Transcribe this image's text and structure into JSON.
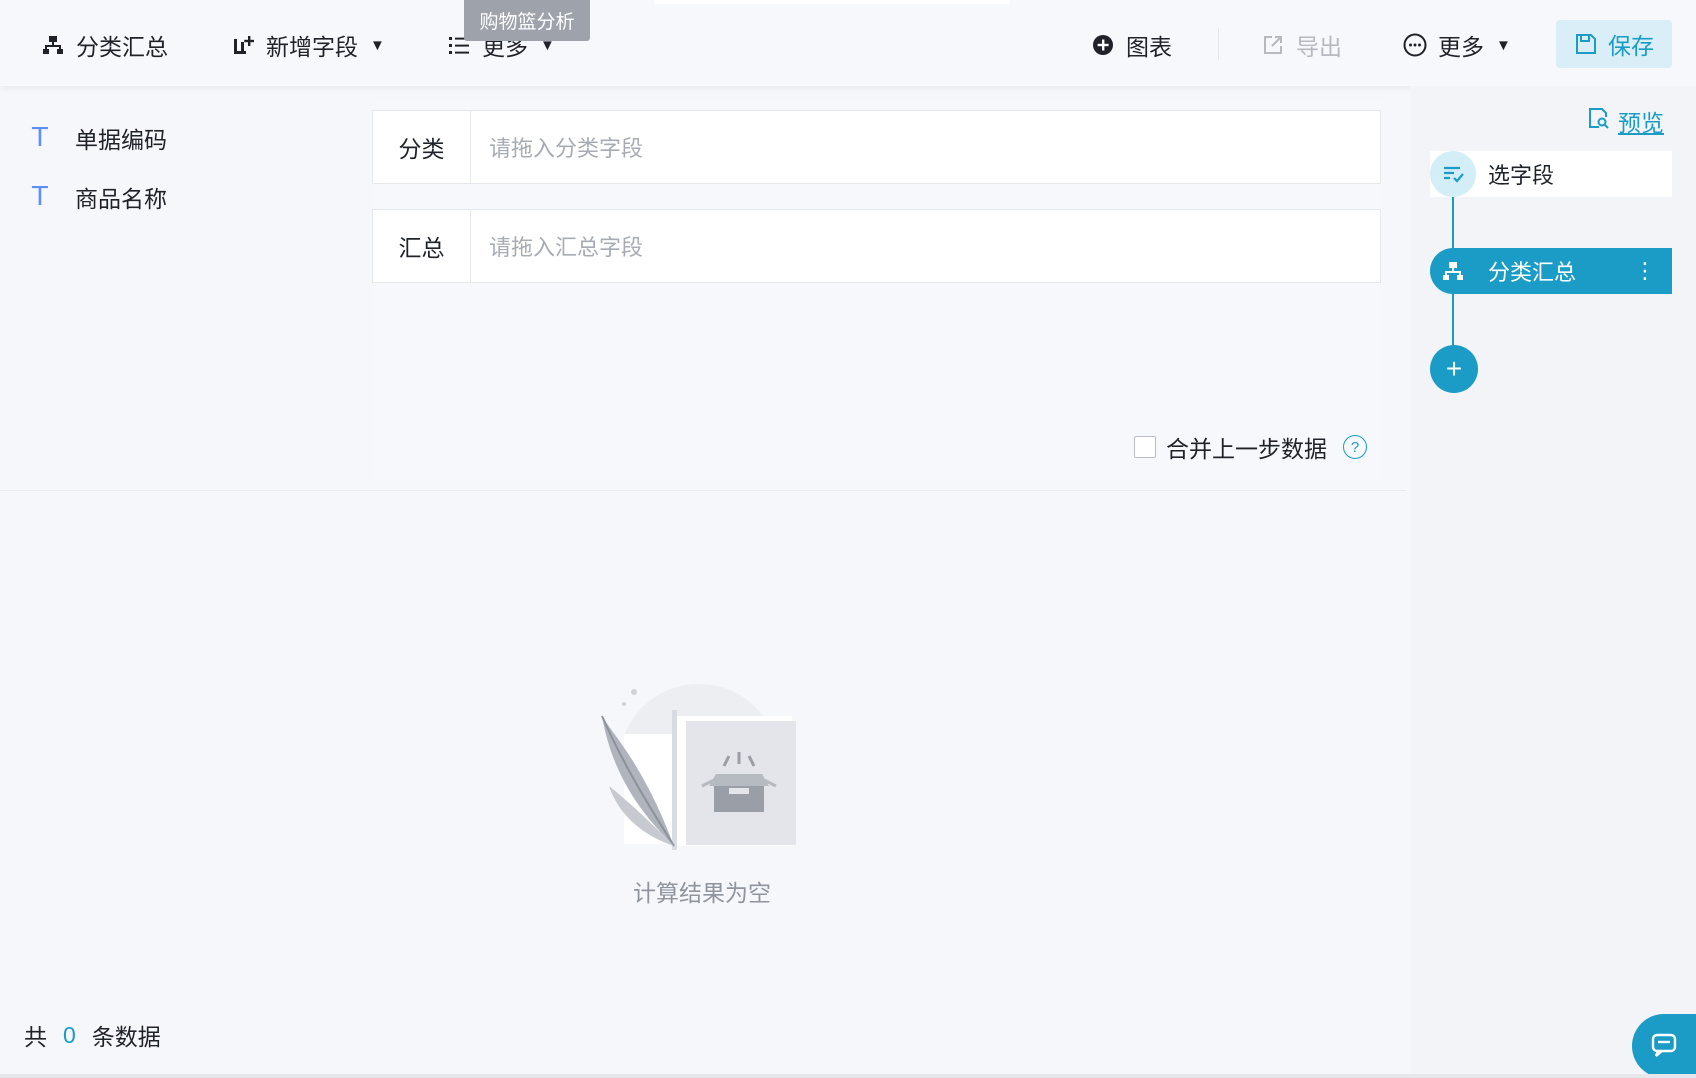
{
  "toolbar": {
    "category_summary": "分类汇总",
    "add_field": "新增字段",
    "more_left": "更多",
    "chart": "图表",
    "export": "导出",
    "more_right": "更多",
    "save": "保存",
    "tooltip": "购物篮分析"
  },
  "fields": [
    {
      "type_icon": "T",
      "label": "单据编码"
    },
    {
      "type_icon": "T",
      "label": "商品名称"
    }
  ],
  "config": {
    "category_label": "分类",
    "category_placeholder": "请拖入分类字段",
    "summary_label": "汇总",
    "summary_placeholder": "请拖入汇总字段",
    "merge_label": "合并上一步数据",
    "help": "?"
  },
  "result": {
    "empty_text": "计算结果为空",
    "footer_prefix": "共",
    "count": "0",
    "footer_suffix": "条数据"
  },
  "pipeline": {
    "preview": "预览",
    "steps": [
      {
        "label": "选字段",
        "icon": "select-fields-icon",
        "active": false
      },
      {
        "label": "分类汇总",
        "icon": "hierarchy-icon",
        "active": true
      }
    ],
    "add": "+"
  },
  "colors": {
    "accent": "#1a9cc6",
    "field_type": "#5b8ff9",
    "placeholder": "#a7acb4"
  }
}
